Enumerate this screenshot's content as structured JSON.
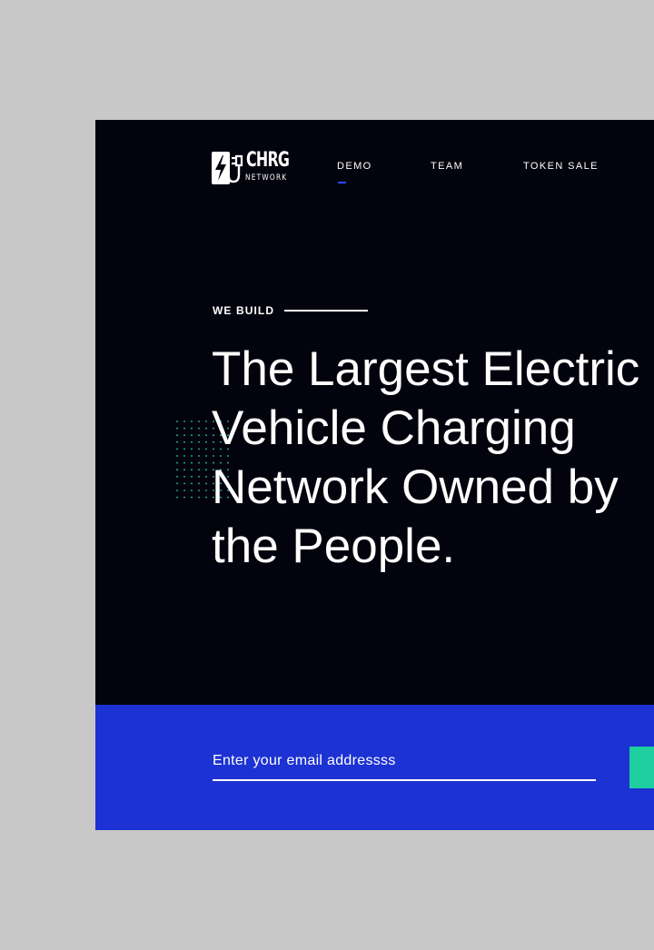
{
  "brand": {
    "name": "CHRG",
    "sub": "NETWORK",
    "mark_icon": "plug-lightning-icon"
  },
  "nav": {
    "items": [
      {
        "label": "DEMO",
        "active": true
      },
      {
        "label": "TEAM",
        "active": false
      },
      {
        "label": "TOKEN SALE",
        "active": false
      }
    ]
  },
  "hero": {
    "eyebrow": "WE BUILD",
    "headline_lines": [
      "The Largest Electric",
      "Vehicle Charging",
      "Network Owned by",
      "the People."
    ]
  },
  "signup": {
    "email_placeholder": "Enter your email addressss"
  },
  "colors": {
    "page_bg": "#c8c8c8",
    "hero_bg": "#03030d",
    "signup_bg": "#1c32d3",
    "accent_blue": "#2a48ff",
    "accent_green": "#1ecfa0",
    "text": "#ffffff"
  }
}
